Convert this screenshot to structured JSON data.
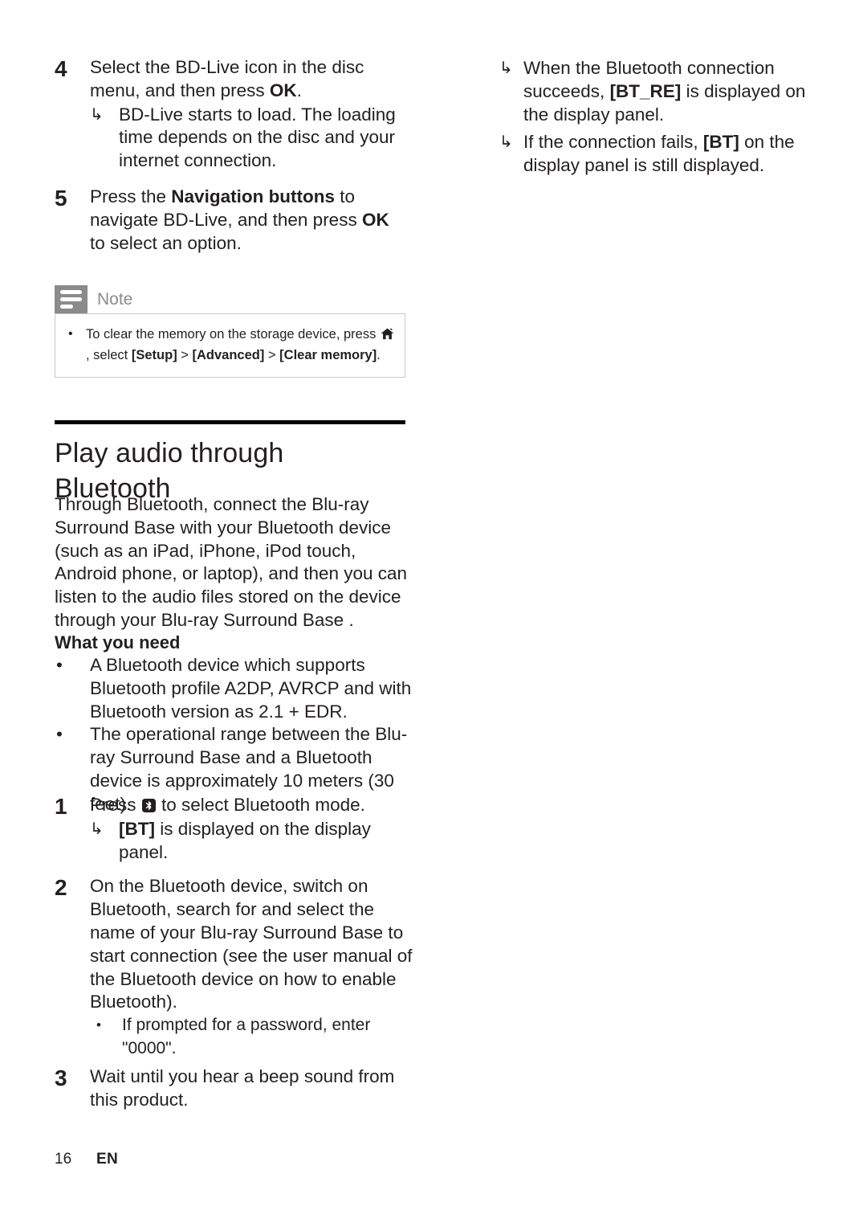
{
  "page": {
    "footer_page_number": "16",
    "footer_language": "EN",
    "accent_gray": "#8b8b8b",
    "text_color": "#231f20",
    "rule_color": "#000000"
  },
  "left_column": {
    "steps_top": [
      {
        "number": "4",
        "text": "Select the BD-Live icon in the disc menu, and then press ",
        "bold_tail": "OK",
        "tail": ".",
        "sub_arrows": [
          {
            "glyph": "↳",
            "text": "BD-Live starts to load. The loading time depends on the disc and your internet connection."
          }
        ]
      },
      {
        "number": "5",
        "text_pre": "Press the ",
        "bold_1": "Navigation buttons",
        "text_mid": " to navigate BD-Live, and then press ",
        "bold_2": "OK",
        "text_post": " to select an option.",
        "sub_arrows": []
      }
    ],
    "note": {
      "title": "Note",
      "bullet_glyph": "•",
      "text_1": "To clear the memory on the storage device, press ",
      "home_icon_name": "home-icon",
      "text_2": ", select ",
      "bold_setup": "[Setup]",
      "sep_1": " > ",
      "bold_advanced": "[Advanced]",
      "sep_2": " > ",
      "bold_clear": "[Clear memory]",
      "text_end": "."
    },
    "section": {
      "title": "Play audio through Bluetooth",
      "intro": "Through Bluetooth, connect the Blu-ray Surround Base  with your Bluetooth device (such as an iPad, iPhone, iPod touch, Android phone, or laptop), and then you can listen to the audio files stored on the device through your Blu-ray Surround Base .",
      "subheading": "What you need",
      "bullet_glyph": "•",
      "requirements": [
        "A Bluetooth device which supports Bluetooth profile A2DP, AVRCP and with Bluetooth version as 2.1 + EDR.",
        "The operational range between the Blu-ray Surround Base  and a Bluetooth device is approximately 10 meters (30 feet)."
      ]
    },
    "steps_bottom": [
      {
        "number": "1",
        "text_pre": "Press ",
        "icon": "bluetooth-icon",
        "text_post": " to select Bluetooth mode.",
        "sub_arrows": [
          {
            "glyph": "↳",
            "bold_lead": "[BT]",
            "text": " is displayed on the display panel."
          }
        ]
      },
      {
        "number": "2",
        "text": "On the Bluetooth device, switch on Bluetooth, search for and select the name of your Blu-ray Surround Base  to start connection (see the user manual of the Bluetooth device on how to enable Bluetooth).",
        "sub_bullets": [
          {
            "glyph": "•",
            "text": "If prompted for a password, enter \"0000\"."
          }
        ]
      },
      {
        "number": "3",
        "text": "Wait until you hear a beep sound from this product.",
        "sub_bullets": []
      }
    ]
  },
  "right_column": {
    "arrow_items": [
      {
        "glyph": "↳",
        "text_pre": "When the Bluetooth connection succeeds, ",
        "bold": "[BT_RE]",
        "text_post": " is displayed on the display panel."
      },
      {
        "glyph": "↳",
        "text_pre": "If the connection fails, ",
        "bold": "[BT]",
        "text_post": " on the display panel is still displayed."
      }
    ]
  }
}
